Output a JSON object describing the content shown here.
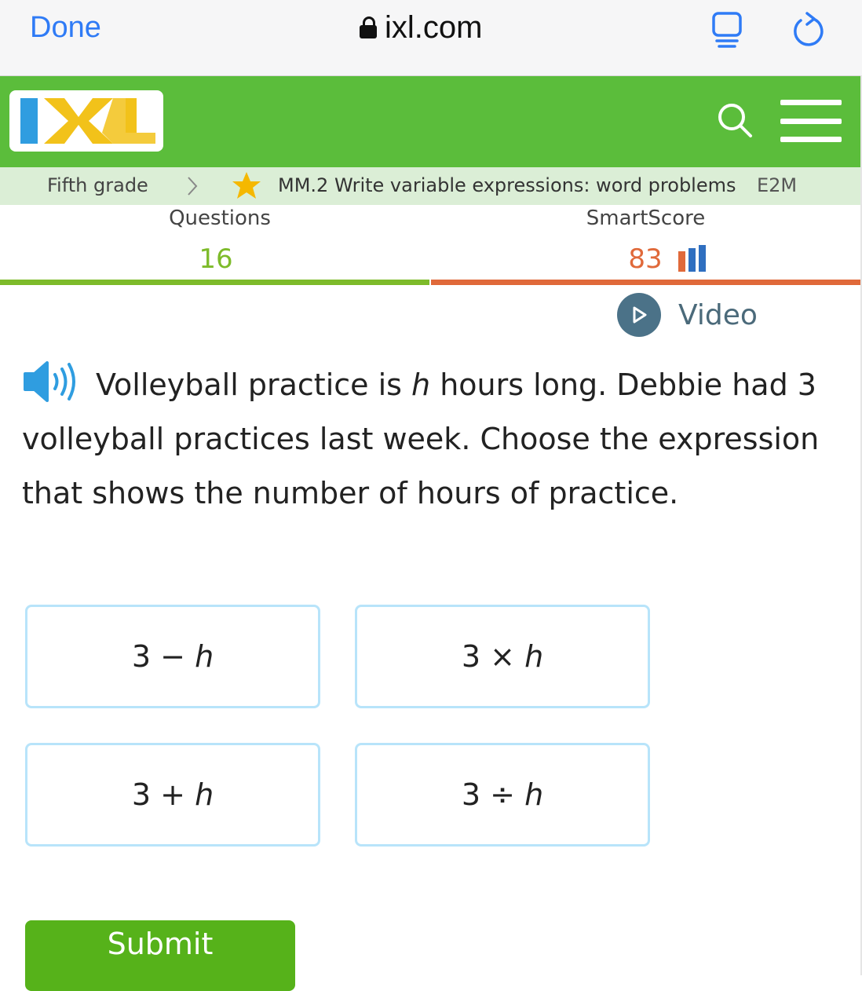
{
  "browser": {
    "done_label": "Done",
    "url": "ixl.com"
  },
  "header": {
    "logo_text": "IXL",
    "colors": {
      "green": "#5bbd3b",
      "logo_blue": "#2f9de0",
      "logo_yellow": "#f2c21a"
    }
  },
  "breadcrumb": {
    "grade": "Fifth grade",
    "skill": "MM.2 Write variable expressions: word problems",
    "code": "E2M"
  },
  "stats": {
    "questions_label": "Questions",
    "questions_value": "16",
    "smartscore_label": "SmartScore",
    "smartscore_value": "83",
    "colors": {
      "questions": "#7dbb2a",
      "smartscore": "#e0693a"
    }
  },
  "video": {
    "label": "Video"
  },
  "question": {
    "text_before": "Volleyball practice is ",
    "variable": "h",
    "text_after": " hours long. Debbie had 3 volleyball practices last week. Choose the expression that shows the number of hours of practice."
  },
  "answers": [
    {
      "left": "3",
      "op": "−",
      "var": "h"
    },
    {
      "left": "3",
      "op": "×",
      "var": "h"
    },
    {
      "left": "3",
      "op": "+",
      "var": "h"
    },
    {
      "left": "3",
      "op": "÷",
      "var": "h"
    }
  ],
  "submit": {
    "label": "Submit"
  }
}
